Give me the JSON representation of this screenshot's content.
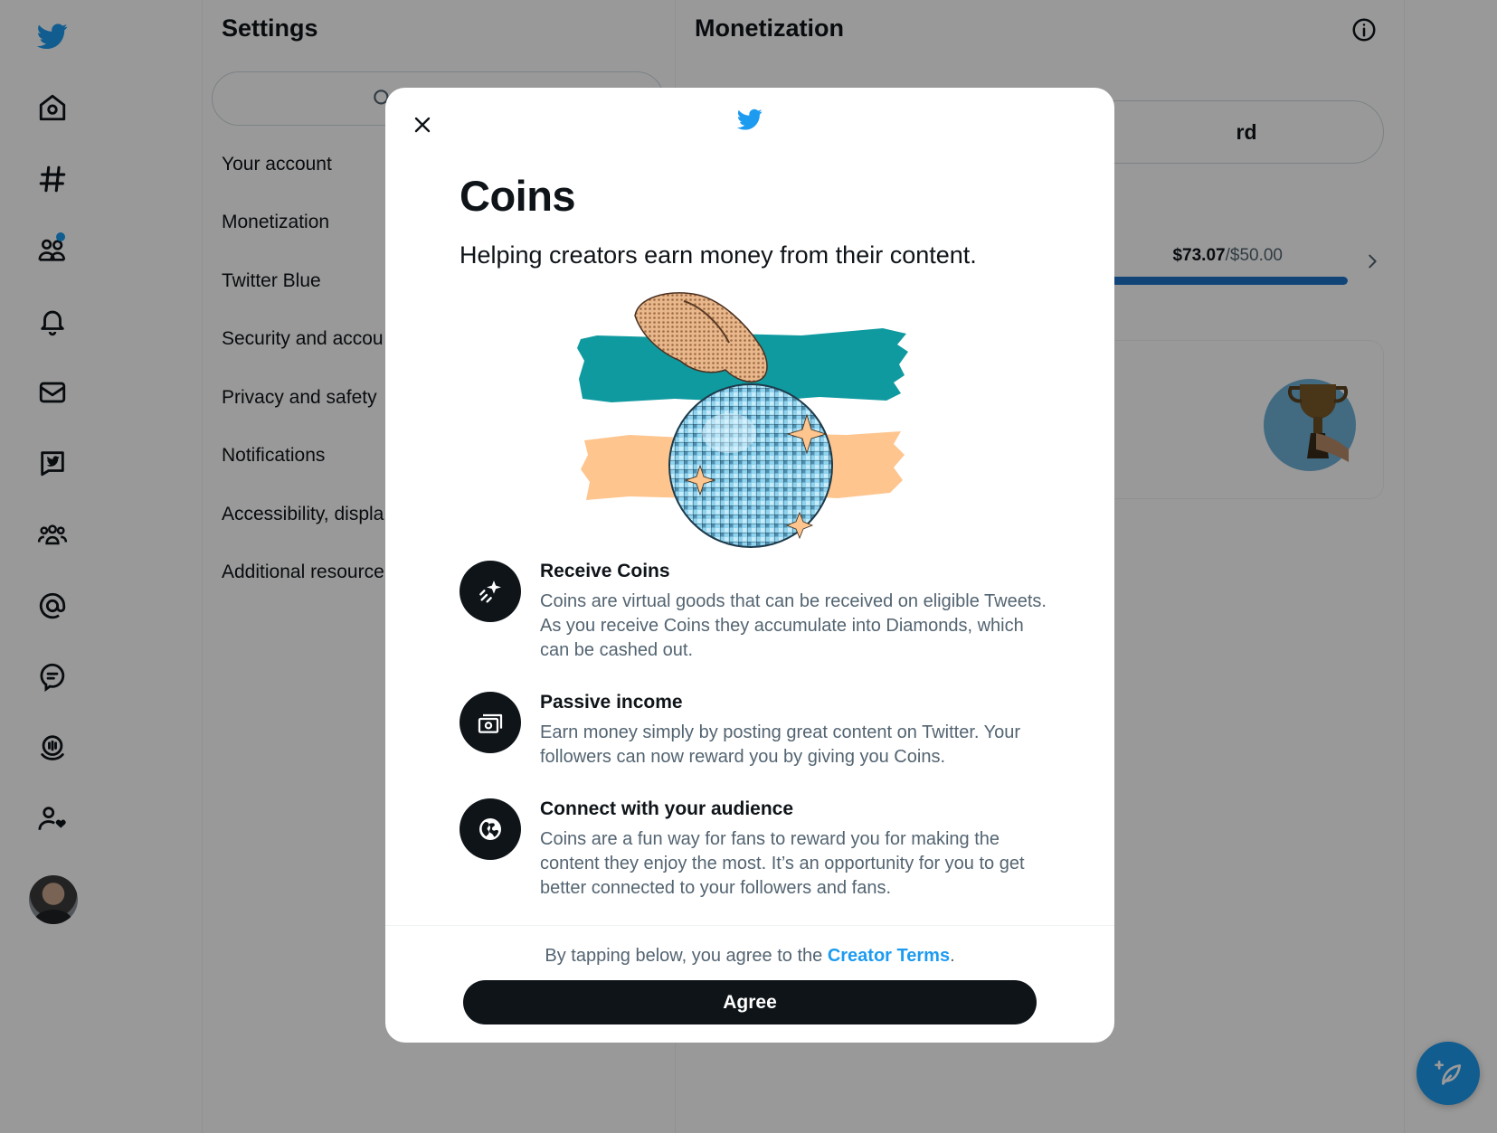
{
  "nav": {
    "items": [
      {
        "icon": "twitter-logo-icon"
      },
      {
        "icon": "home-icon"
      },
      {
        "icon": "explore-hashtag-icon"
      },
      {
        "icon": "communities-icon",
        "has_notification_dot": true
      },
      {
        "icon": "notifications-bell-icon"
      },
      {
        "icon": "messages-envelope-icon"
      },
      {
        "icon": "twitter-blue-icon"
      },
      {
        "icon": "people-icon"
      },
      {
        "icon": "mention-at-icon"
      },
      {
        "icon": "topics-icon"
      },
      {
        "icon": "spaces-icon"
      },
      {
        "icon": "follow-requests-icon"
      }
    ]
  },
  "settings": {
    "title": "Settings",
    "items": [
      {
        "label": "Your account"
      },
      {
        "label": "Monetization"
      },
      {
        "label": "Twitter Blue"
      },
      {
        "label": "Security and accou"
      },
      {
        "label": "Privacy and safety"
      },
      {
        "label": "Notifications"
      },
      {
        "label": "Accessibility, displa"
      },
      {
        "label": "Additional resource"
      }
    ]
  },
  "main": {
    "title": "Monetization",
    "dashboard_button_partial": "rd",
    "progress": {
      "earned": "$73.07",
      "separator": "/",
      "goal": "$50.00",
      "fill_fraction": 1.0
    }
  },
  "modal": {
    "title": "Coins",
    "subtitle": "Helping creators earn money from their content.",
    "features": [
      {
        "icon": "sparkle-star-icon",
        "title": "Receive Coins",
        "description": "Coins are virtual goods that can be received on eligible Tweets. As you receive Coins they accumulate into Diamonds, which can be cashed out."
      },
      {
        "icon": "money-stack-icon",
        "title": "Passive income",
        "description": "Earn money simply by posting great content on Twitter. Your followers can now reward you by giving you Coins."
      },
      {
        "icon": "globe-icon",
        "title": "Connect with your audience",
        "description": "Coins are a fun way for fans to reward you for making the content they enjoy the most. It’s an opportunity for you to get better connected to your followers and fans."
      }
    ],
    "terms_prefix": "By tapping below, you agree to the ",
    "terms_link": "Creator Terms",
    "terms_suffix": ".",
    "agree_label": "Agree"
  },
  "colors": {
    "accent": "#1d9bf0",
    "primary_text": "#0f1419",
    "secondary_text": "#536471",
    "overlay": "rgba(0,0,0,0.40)",
    "progress_fill": "#1d74c9",
    "hero_teal": "#0f9aa0",
    "hero_peach": "#ffc58e"
  }
}
